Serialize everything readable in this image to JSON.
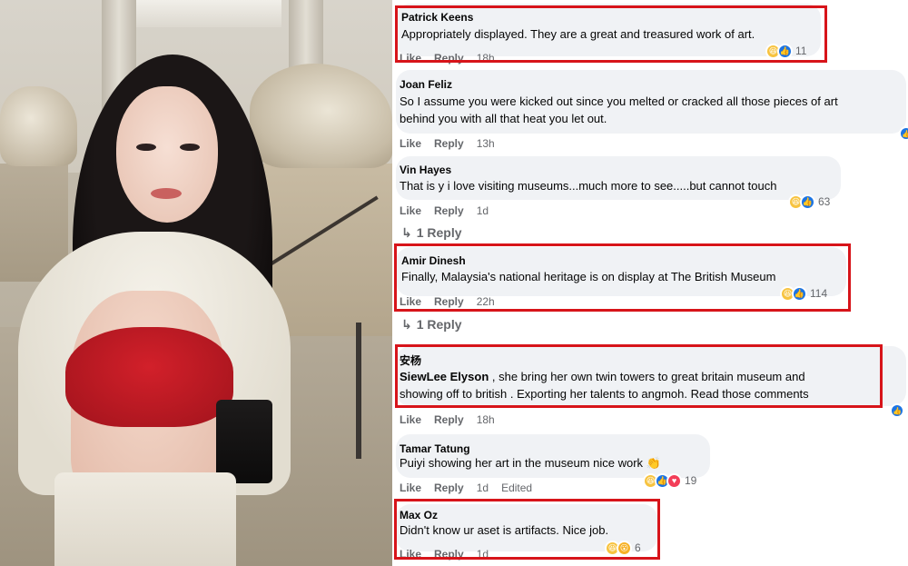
{
  "comments": [
    {
      "name": "Patrick Keens",
      "lines": [
        "Appropriately displayed. They are a great and treasured work of art."
      ],
      "like": "Like",
      "reply": "Reply",
      "time": "18h",
      "reactions": [
        "haha-icon",
        "like-icon"
      ],
      "reaction_count": "11"
    },
    {
      "name": "Joan Feliz",
      "lines": [
        "So I assume you were kicked out since you melted or cracked all those pieces of art",
        "behind you with all that heat you let out."
      ],
      "like": "Like",
      "reply": "Reply",
      "time": "13h"
    },
    {
      "name": "Vin Hayes",
      "lines": [
        "That is y i love visiting museums...much more to see.....but cannot touch"
      ],
      "like": "Like",
      "reply": "Reply",
      "time": "1d",
      "reactions": [
        "haha-icon",
        "like-icon"
      ],
      "reaction_count": "63",
      "replies": "1 Reply"
    },
    {
      "name": "Amir Dinesh",
      "lines": [
        "Finally, Malaysia's national heritage is on display at The British Museum"
      ],
      "like": "Like",
      "reply": "Reply",
      "time": "22h",
      "reactions": [
        "haha-icon",
        "like-icon"
      ],
      "reaction_count": "114",
      "replies": "1 Reply"
    },
    {
      "name": "安杨",
      "tag": "SiewLee Elyson",
      "lines": [
        " , she bring her own twin towers to great britain museum and",
        "showing off to british . Exporting her talents to angmoh. Read those comments"
      ],
      "like": "Like",
      "reply": "Reply",
      "time": "18h"
    },
    {
      "name": "Tamar Tatung",
      "lines": [
        "Puiyi showing her art in the museum nice work 👏"
      ],
      "like": "Like",
      "reply": "Reply",
      "time": "1d",
      "edited": "Edited",
      "reactions": [
        "haha-icon",
        "like-icon",
        "love-icon"
      ],
      "reaction_count": "19"
    },
    {
      "name": "Max Oz",
      "lines": [
        "Didn't know ur aset is artifacts. Nice job."
      ],
      "like": "Like",
      "reply": "Reply",
      "time": "1d",
      "reactions": [
        "haha-icon",
        "wow-icon"
      ],
      "reaction_count": "6"
    }
  ],
  "colors": {
    "bubble": "#f0f2f5",
    "highlight_box": "#d7141a",
    "like_blue": "#1b74e4",
    "haha_yellow": "#f7c33f",
    "love_red": "#f33e58",
    "meta_gray": "#65676b"
  }
}
